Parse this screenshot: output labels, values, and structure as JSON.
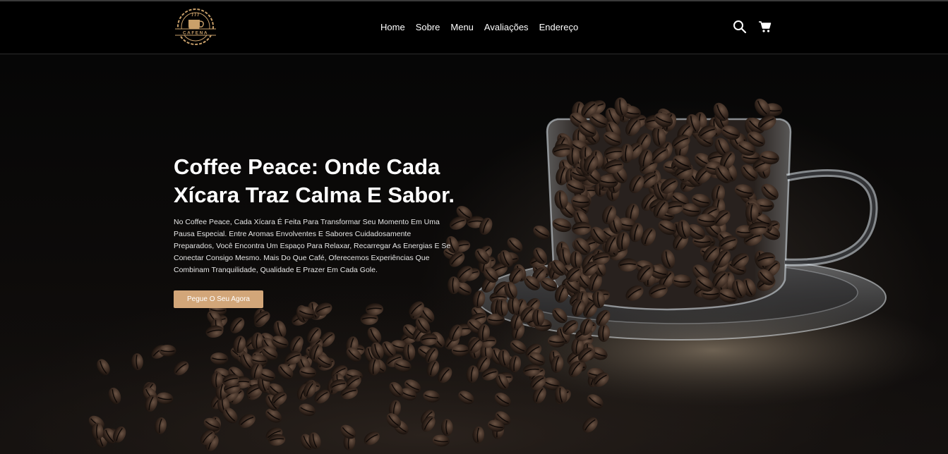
{
  "header": {
    "logo_text": "CAFENA",
    "nav": [
      "Home",
      "Sobre",
      "Menu",
      "Avaliações",
      "Endereço"
    ],
    "icons": [
      "search-icon",
      "cart-icon"
    ]
  },
  "hero": {
    "title": "Coffee Peace: Onde Cada Xícara Traz Calma E Sabor.",
    "description": "No Coffee Peace, Cada Xícara É Feita Para Transformar Seu Momento Em Uma Pausa Especial. Entre Aromas Envolventes E Sabores Cuidadosamente Preparados, Você Encontra Um Espaço Para Relaxar, Recarregar As Energias E Se Conectar Consigo Mesmo. Mais Do Que Café, Oferecemos Experiências Que Combinam Tranquilidade, Qualidade E Prazer Em Cada Gole.",
    "cta_label": "Pegue O Seu Agora"
  },
  "colors": {
    "accent": "#d2a679",
    "header_bg": "#000000"
  }
}
